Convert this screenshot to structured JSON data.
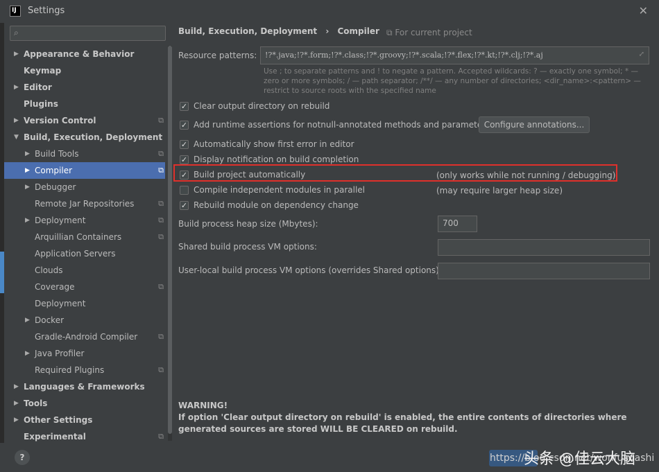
{
  "window": {
    "title": "Settings",
    "app_icon_text": "IJ"
  },
  "search": {
    "placeholder": ""
  },
  "tree": [
    {
      "label": "Appearance & Behavior",
      "level": 0,
      "bold": true,
      "arrow": "right",
      "proj": false,
      "selected": false
    },
    {
      "label": "Keymap",
      "level": 0,
      "bold": true,
      "arrow": "",
      "proj": false,
      "selected": false
    },
    {
      "label": "Editor",
      "level": 0,
      "bold": true,
      "arrow": "right",
      "proj": false,
      "selected": false
    },
    {
      "label": "Plugins",
      "level": 0,
      "bold": true,
      "arrow": "",
      "proj": false,
      "selected": false
    },
    {
      "label": "Version Control",
      "level": 0,
      "bold": true,
      "arrow": "right",
      "proj": true,
      "selected": false
    },
    {
      "label": "Build, Execution, Deployment",
      "level": 0,
      "bold": true,
      "arrow": "down",
      "proj": false,
      "selected": false
    },
    {
      "label": "Build Tools",
      "level": 1,
      "bold": false,
      "arrow": "right",
      "proj": true,
      "selected": false
    },
    {
      "label": "Compiler",
      "level": 1,
      "bold": false,
      "arrow": "right",
      "proj": true,
      "selected": true
    },
    {
      "label": "Debugger",
      "level": 1,
      "bold": false,
      "arrow": "right",
      "proj": false,
      "selected": false
    },
    {
      "label": "Remote Jar Repositories",
      "level": 1,
      "bold": false,
      "arrow": "",
      "proj": true,
      "selected": false
    },
    {
      "label": "Deployment",
      "level": 1,
      "bold": false,
      "arrow": "right",
      "proj": true,
      "selected": false
    },
    {
      "label": "Arquillian Containers",
      "level": 1,
      "bold": false,
      "arrow": "",
      "proj": true,
      "selected": false
    },
    {
      "label": "Application Servers",
      "level": 1,
      "bold": false,
      "arrow": "",
      "proj": false,
      "selected": false
    },
    {
      "label": "Clouds",
      "level": 1,
      "bold": false,
      "arrow": "",
      "proj": false,
      "selected": false
    },
    {
      "label": "Coverage",
      "level": 1,
      "bold": false,
      "arrow": "",
      "proj": true,
      "selected": false
    },
    {
      "label": "Deployment",
      "level": 1,
      "bold": false,
      "arrow": "",
      "proj": false,
      "selected": false
    },
    {
      "label": "Docker",
      "level": 1,
      "bold": false,
      "arrow": "right",
      "proj": false,
      "selected": false
    },
    {
      "label": "Gradle-Android Compiler",
      "level": 1,
      "bold": false,
      "arrow": "",
      "proj": true,
      "selected": false
    },
    {
      "label": "Java Profiler",
      "level": 1,
      "bold": false,
      "arrow": "right",
      "proj": false,
      "selected": false
    },
    {
      "label": "Required Plugins",
      "level": 1,
      "bold": false,
      "arrow": "",
      "proj": true,
      "selected": false
    },
    {
      "label": "Languages & Frameworks",
      "level": 0,
      "bold": true,
      "arrow": "right",
      "proj": false,
      "selected": false
    },
    {
      "label": "Tools",
      "level": 0,
      "bold": true,
      "arrow": "right",
      "proj": false,
      "selected": false
    },
    {
      "label": "Other Settings",
      "level": 0,
      "bold": true,
      "arrow": "right",
      "proj": false,
      "selected": false
    },
    {
      "label": "Experimental",
      "level": 0,
      "bold": true,
      "arrow": "",
      "proj": true,
      "selected": false
    }
  ],
  "main": {
    "breadcrumb": [
      "Build, Execution, Deployment",
      "›",
      "Compiler"
    ],
    "for_project": "For current project",
    "resource_patterns_label": "Resource patterns:",
    "resource_patterns_value": "!?*.java;!?*.form;!?*.class;!?*.groovy;!?*.scala;!?*.flex;!?*.kt;!?*.clj;!?*.aj",
    "hint": "Use ; to separate patterns and ! to negate a pattern. Accepted wildcards: ? — exactly one symbol; * — zero or more symbols; / — path separator; /**/ — any number of directories; <dir_name>:<pattern> — restrict to source roots with the specified name",
    "checkboxes": [
      {
        "label": "Clear output directory on rebuild",
        "checked": true,
        "note": ""
      },
      {
        "label": "Add runtime assertions for notnull-annotated methods and parameters",
        "checked": true,
        "note": ""
      },
      {
        "label": "Automatically show first error in editor",
        "checked": true,
        "note": ""
      },
      {
        "label": "Display notification on build completion",
        "checked": true,
        "note": ""
      },
      {
        "label": "Build project automatically",
        "checked": true,
        "note": "(only works while not running / debugging)"
      },
      {
        "label": "Compile independent modules in parallel",
        "checked": false,
        "note": "(may require larger heap size)"
      },
      {
        "label": "Rebuild module on dependency change",
        "checked": true,
        "note": ""
      }
    ],
    "configure_button": "Configure annotations...",
    "heap_label": "Build process heap size (Mbytes):",
    "heap_value": "700",
    "shared_vm_label": "Shared build process VM options:",
    "shared_vm_value": "",
    "user_vm_label": "User-local build process VM options (overrides Shared options):",
    "user_vm_value": "",
    "warning_title": "WARNING!",
    "warning_text": "If option 'Clear output directory on rebuild' is enabled, the entire contents of directories where generated sources are stored WILL BE CLEARED on rebuild."
  },
  "bottom": {
    "help": "?",
    "watermark_url": "https://blog.csdn.net/wonfusdashi",
    "watermark_cn": "头条 @佳云大脑"
  },
  "colors": {
    "selection": "#4b6eaf",
    "highlight_border": "#e0302b",
    "background": "#3c3f41"
  }
}
